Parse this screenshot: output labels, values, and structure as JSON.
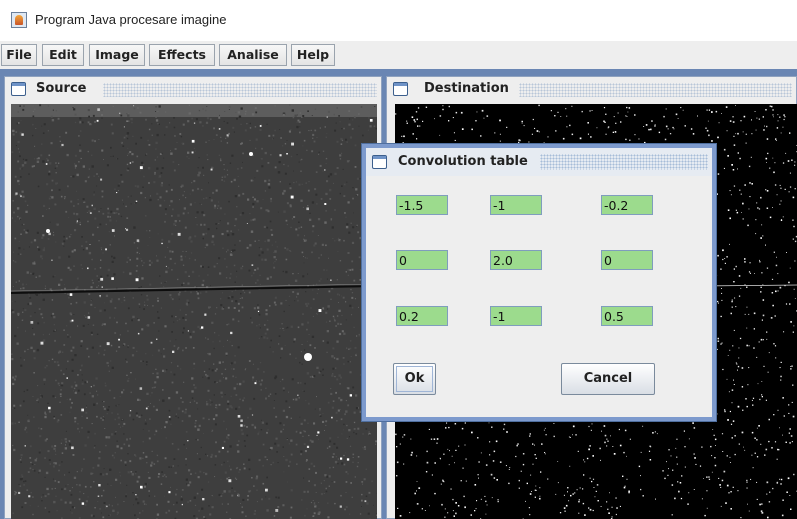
{
  "window": {
    "title": "Program Java procesare imagine",
    "icon": "java-cup-icon"
  },
  "menu": {
    "items": [
      {
        "label": "File"
      },
      {
        "label": "Edit"
      },
      {
        "label": "Image"
      },
      {
        "label": "Effects"
      },
      {
        "label": "Analise"
      },
      {
        "label": "Help"
      }
    ]
  },
  "source_frame": {
    "title": "Source",
    "icon": "window-icon"
  },
  "destination_frame": {
    "title": "Destination",
    "icon": "window-icon"
  },
  "dialog": {
    "title": "Convolution table",
    "icon": "window-icon",
    "kernel": [
      [
        "-1.5",
        "-1",
        "-0.2"
      ],
      [
        "0",
        "2.0",
        "0"
      ],
      [
        "0.2",
        "-1",
        "0.5"
      ]
    ],
    "ok_label": "Ok",
    "cancel_label": "Cancel"
  },
  "colors": {
    "desktop": "#6a86b3",
    "cell_background": "#9cdb8d",
    "dialog_border": "#7d9acd"
  }
}
